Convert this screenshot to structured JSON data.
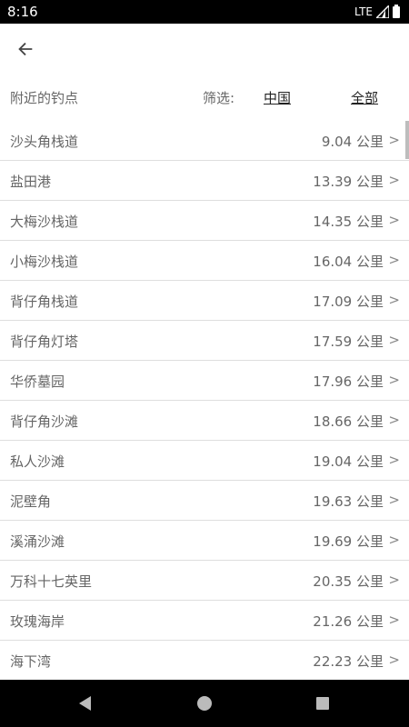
{
  "status_bar": {
    "time": "8:16",
    "network": "LTE"
  },
  "filter": {
    "title": "附近的钓点",
    "label": "筛选:",
    "options": [
      "中国",
      "全部"
    ]
  },
  "spots": [
    {
      "name": "沙头角栈道",
      "distance": "9.04 公里"
    },
    {
      "name": "盐田港",
      "distance": "13.39 公里"
    },
    {
      "name": "大梅沙栈道",
      "distance": "14.35 公里"
    },
    {
      "name": "小梅沙栈道",
      "distance": "16.04 公里"
    },
    {
      "name": "背仔角栈道",
      "distance": "17.09 公里"
    },
    {
      "name": "背仔角灯塔",
      "distance": "17.59 公里"
    },
    {
      "name": "华侨墓园",
      "distance": "17.96 公里"
    },
    {
      "name": "背仔角沙滩",
      "distance": "18.66 公里"
    },
    {
      "name": "私人沙滩",
      "distance": "19.04 公里"
    },
    {
      "name": "泥壁角",
      "distance": "19.63 公里"
    },
    {
      "name": "溪涌沙滩",
      "distance": "19.69 公里"
    },
    {
      "name": "万科十七英里",
      "distance": "20.35 公里"
    },
    {
      "name": "玫瑰海岸",
      "distance": "21.26 公里"
    },
    {
      "name": "海下湾",
      "distance": "22.23 公里"
    }
  ],
  "chevron": ">",
  "icons": {
    "back": "arrow-left-icon",
    "signal": "signal-icon",
    "battery": "battery-icon",
    "nav_back": "triangle-back-icon",
    "nav_home": "circle-home-icon",
    "nav_recents": "square-recents-icon"
  }
}
